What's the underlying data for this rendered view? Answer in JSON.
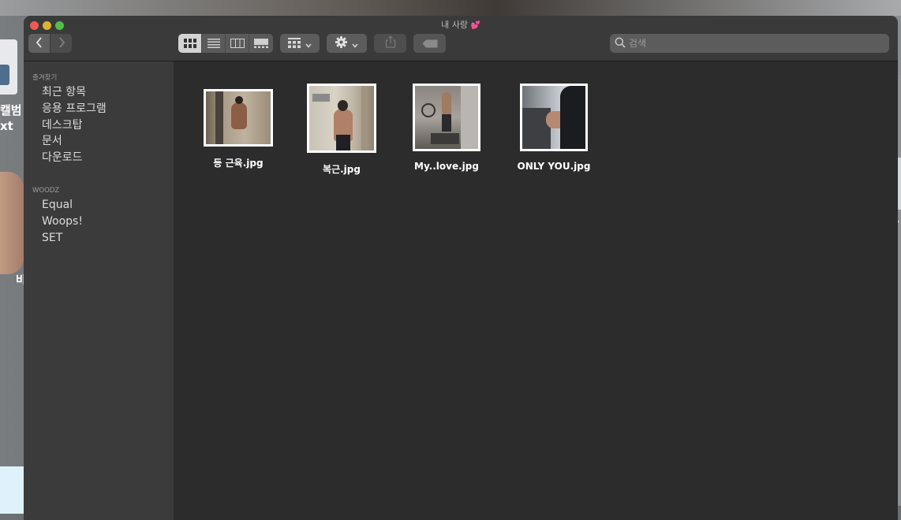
{
  "desktop": {
    "label_1": "캘범",
    "label_2": "xt",
    "label_3": "비",
    "right_label": "r"
  },
  "window": {
    "title": "내 사랑",
    "title_emoji": "💕"
  },
  "toolbar": {
    "back_icon": "chevron-left-icon",
    "forward_icon": "chevron-right-icon",
    "active_view": "icon",
    "views": [
      "icon",
      "list",
      "column",
      "gallery"
    ],
    "group_icon": "grid-icon",
    "action_icon": "gear-icon",
    "share_icon": "share-icon",
    "tag_icon": "tag-icon"
  },
  "search": {
    "placeholder": "검색"
  },
  "sidebar": {
    "sections": [
      {
        "header": "즐겨찾기",
        "items": [
          {
            "label": "최근 항목"
          },
          {
            "label": "응용 프로그램"
          },
          {
            "label": "데스크탑"
          },
          {
            "label": "문서"
          },
          {
            "label": "다운로드"
          }
        ]
      },
      {
        "header": "WOODZ",
        "items": [
          {
            "label": "Equal"
          },
          {
            "label": "Woops!"
          },
          {
            "label": "SET"
          }
        ]
      }
    ]
  },
  "files": [
    {
      "name": "등 근육.jpg"
    },
    {
      "name": "복근.jpg"
    },
    {
      "name": "My..love.jpg"
    },
    {
      "name": "ONLY YOU.jpg"
    }
  ],
  "colors": {
    "window_bg": "#2c2c2c",
    "sidebar_bg": "#3b3b3b",
    "titlebar_bg": "#3a3a3a",
    "close": "#ee5a52",
    "minimize": "#d9b534",
    "zoom": "#4fc244"
  }
}
